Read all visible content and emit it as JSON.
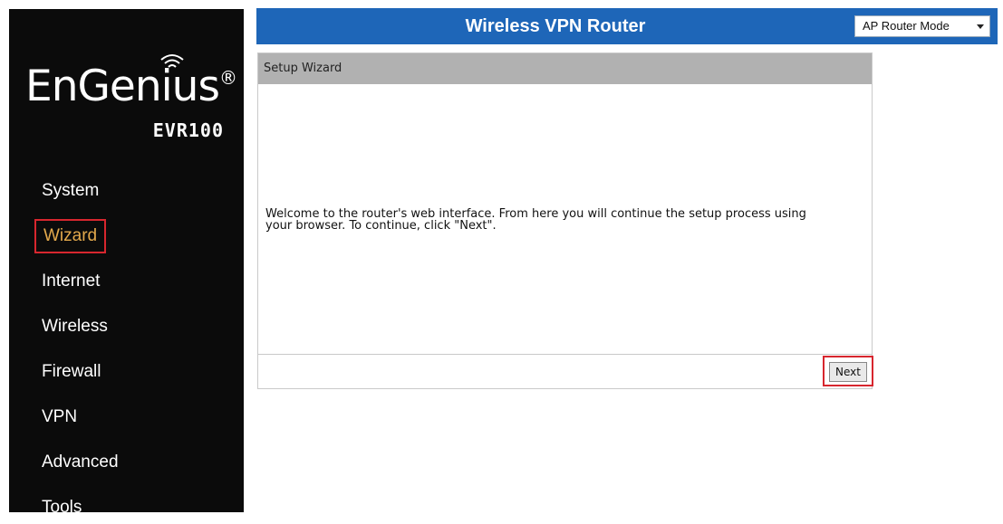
{
  "brand": {
    "logo_text": "EnGenius",
    "registered_mark": "®",
    "model": "EVR100"
  },
  "nav": {
    "items": [
      {
        "label": "System"
      },
      {
        "label": "Wizard",
        "active": true
      },
      {
        "label": "Internet"
      },
      {
        "label": "Wireless"
      },
      {
        "label": "Firewall"
      },
      {
        "label": "VPN"
      },
      {
        "label": "Advanced"
      },
      {
        "label": "Tools"
      }
    ]
  },
  "header": {
    "title": "Wireless VPN Router",
    "mode_select": {
      "selected": "AP Router Mode"
    }
  },
  "panel": {
    "title": "Setup Wizard",
    "message_line1": "Welcome to the router's web interface. From here you will continue the setup process using",
    "message_line2": "your browser. To continue, click \"Next\".",
    "next_label": "Next"
  },
  "colors": {
    "sidebar_bg": "#0b0b0b",
    "topbar_bg": "#1e66b8",
    "active_nav_text": "#e3a94c",
    "highlight_border": "#d7262e",
    "panel_header_bg": "#b1b1b1"
  },
  "icons": [
    "wifi-signal-icon",
    "chevron-down-icon"
  ]
}
